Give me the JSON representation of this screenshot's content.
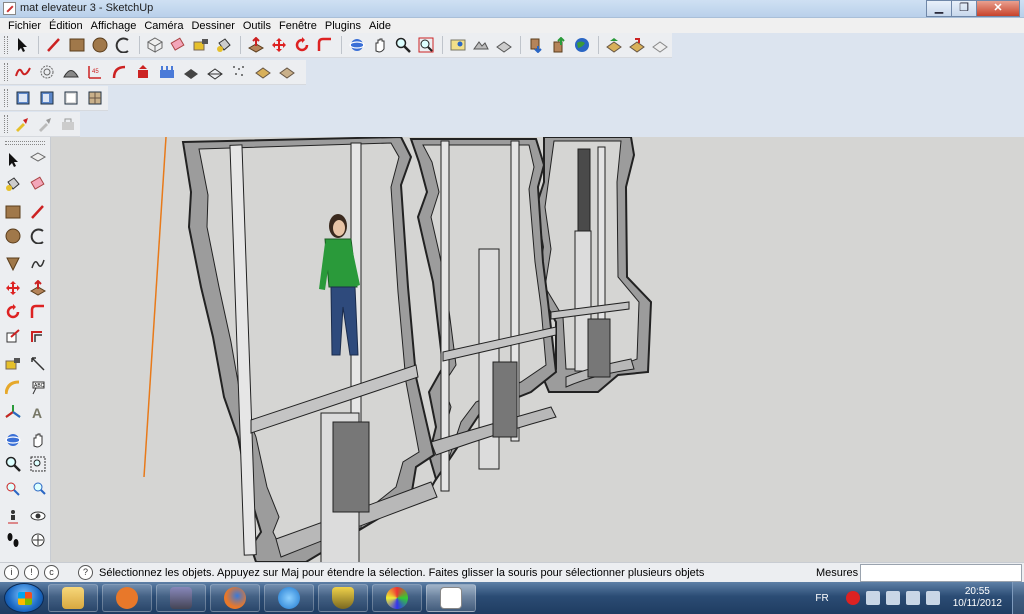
{
  "window": {
    "title": "mat elevateur 3 - SketchUp",
    "minimize": "▁",
    "maximize": "❐",
    "close": "✕"
  },
  "menu": [
    "Fichier",
    "Édition",
    "Affichage",
    "Caméra",
    "Dessiner",
    "Outils",
    "Fenêtre",
    "Plugins",
    "Aide"
  ],
  "toolbars": {
    "main": [
      "select-tool",
      "line-tool",
      "rectangle-tool",
      "circle-tool",
      "arc-tool",
      "make-component-tool",
      "eraser-tool",
      "tape-measure-tool",
      "paint-bucket-tool",
      "push-pull-tool",
      "move-tool",
      "rotate-tool",
      "follow-me-tool",
      "orbit-tool",
      "pan-tool",
      "zoom-tool",
      "zoom-extents-tool",
      "add-location-tool",
      "toggle-terrain-tool",
      "get-models-tool",
      "share-model-tool",
      "google-earth-tool",
      "previous-view-tool",
      "next-view-tool",
      "section-plane-tool"
    ],
    "sandbox": [
      "freehand-tool",
      "from-contours-tool",
      "smoove-tool",
      "dimension-tool",
      "arc-offset-tool",
      "stamp-tool",
      "drape-tool",
      "add-detail-tool",
      "flip-edge-tool",
      "terrain-tool",
      "terrain-scatter-tool"
    ],
    "views": [
      "front-view",
      "right-view",
      "back-view",
      "left-view"
    ],
    "layers": [
      "component-layer-tool",
      "outliner-tool",
      "shadows-tool"
    ]
  },
  "left_tools": [
    [
      "select-tool",
      "make-component-tool"
    ],
    [
      "paint-bucket-tool",
      "eraser-tool"
    ],
    [
      "rectangle-tool",
      "line-tool"
    ],
    [
      "circle-tool",
      "arc-tool"
    ],
    [
      "polygon-tool",
      "freehand-tool"
    ],
    [
      "move-tool",
      "push-pull-tool"
    ],
    [
      "rotate-tool",
      "follow-me-tool"
    ],
    [
      "scale-tool",
      "offset-tool"
    ],
    [
      "tape-measure-tool",
      "dimension-tool"
    ],
    [
      "protractor-tool",
      "text-tool"
    ],
    [
      "axes-tool",
      "3d-text-tool"
    ],
    [
      "orbit-tool",
      "pan-tool"
    ],
    [
      "zoom-tool",
      "zoom-window-tool"
    ],
    [
      "zoom-extents-tool",
      "previous-tool"
    ],
    [
      "position-camera-tool",
      "look-around-tool"
    ],
    [
      "walk-tool",
      "section-plane-tool"
    ]
  ],
  "status": {
    "message": "Sélectionnez les objets. Appuyez sur Maj pour étendre la sélection. Faites glisser la souris pour sélectionner plusieurs objets",
    "measure_label": "Mesures",
    "measure_value": ""
  },
  "taskbar": {
    "apps": [
      "explorer",
      "media-player",
      "game",
      "firefox",
      "internet-explorer",
      "shield",
      "paint",
      "sketchup"
    ],
    "lang": "FR",
    "time": "20:55",
    "date": "10/11/2012"
  },
  "colors": {
    "axis_orange": "#e87a1a",
    "frame_gray": "#9c9c9c",
    "pipe_light": "#dcdcdc",
    "shirt_green": "#2a9a3a"
  }
}
